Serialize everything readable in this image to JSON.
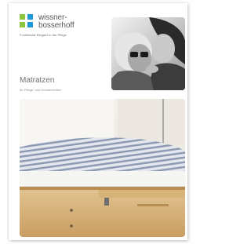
{
  "brand": {
    "line1": "wissner-",
    "line2": "bosserhoff",
    "tagline": "Funktionale Eleganz in der Pflege"
  },
  "cover": {
    "title": "Matratzen",
    "subtitle": "für Pflege- und Krankenbetten"
  },
  "colors": {
    "logo_green": "#8cc63f",
    "logo_blue": "#1d9ad6",
    "text_grey": "#6a6f73"
  }
}
